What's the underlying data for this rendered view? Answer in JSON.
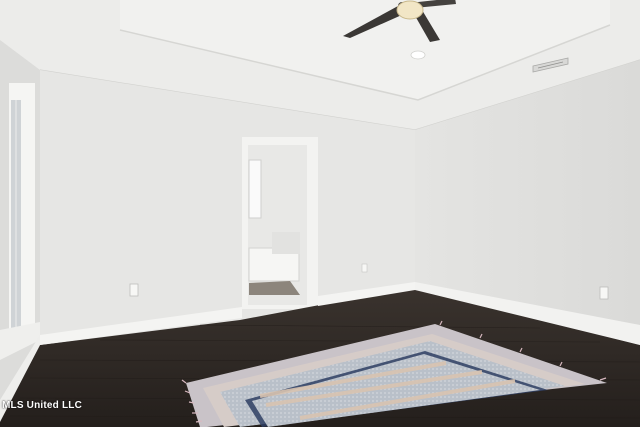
{
  "photo": {
    "description_kind": "empty-room-listing-photo",
    "watermark": "MLS United LLC",
    "colors": {
      "wall": "#e6e6e4",
      "ceiling": "#ececea",
      "floor": "#2e2824",
      "baseboard": "#f4f4f2",
      "rug_border": "#c9c3c8",
      "rug_field": "#b8bfc8",
      "rug_stripe": "#d9c4b1"
    },
    "icons": [
      "ceiling-fan-icon",
      "recessed-light-icon",
      "air-vent-icon"
    ]
  }
}
